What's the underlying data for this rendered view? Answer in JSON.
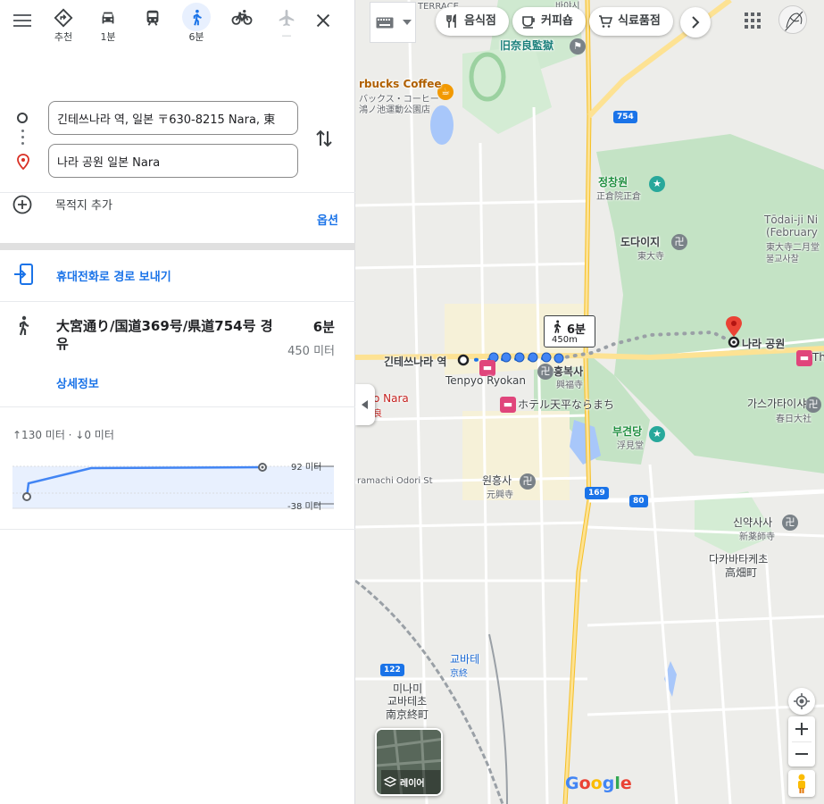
{
  "travel_modes": [
    {
      "id": "best",
      "label": "추천",
      "icon": "diamond-directions-icon"
    },
    {
      "id": "drive",
      "label": "1분",
      "icon": "car-icon"
    },
    {
      "id": "transit",
      "label": "",
      "icon": "train-icon"
    },
    {
      "id": "walk",
      "label": "6분",
      "icon": "walking-icon",
      "active": true
    },
    {
      "id": "bike",
      "label": "",
      "icon": "bicycle-icon"
    },
    {
      "id": "flight",
      "label": "—",
      "icon": "airplane-icon"
    }
  ],
  "directions": {
    "start_value": "긴테쓰나라 역, 일본 〒630-8215 Nara, 東",
    "destination_value": "나라 공원 일본 Nara",
    "add_destination": "목적지 추가",
    "options": "옵션",
    "send_to_phone": "휴대전화로 경로 보내기"
  },
  "route": {
    "name": "大宮通り/国道369号/県道754号 경유",
    "duration": "6분",
    "distance": "450 미터",
    "details": "상세정보"
  },
  "elevation": {
    "summary": "↑130 미터 · ↓0 미터",
    "max_label": "92 미터",
    "min_label": "-38 미터"
  },
  "map": {
    "chips": [
      {
        "label": "음식점",
        "icon": "restaurant-icon"
      },
      {
        "label": "커피숍",
        "icon": "coffee-icon"
      },
      {
        "label": "식료품점",
        "icon": "grocery-cart-icon"
      }
    ],
    "callout": {
      "duration": "6분",
      "distance": "450m"
    },
    "origin_label": "긴테쓰나라 역",
    "destination_label": "나라 공원",
    "layers_label": "레이어",
    "google": "Google",
    "labels": {
      "top": "바야시",
      "terrace": "TERRACE",
      "jail": "旧奈良監獄",
      "starbucks": "rbucks Coffee",
      "starbucks_jp": "バックス・コーヒー",
      "park_jp": "鴻ノ池運動公園店",
      "shosoin": "정창원",
      "shosoin_jp": "正倉院正倉",
      "todaiji_en": "Tōdai-ji Ni",
      "todaiji_en2": "(February",
      "todaiji_jp": "東大寺二月堂",
      "todaiji_kr": "불교사찰",
      "todaiji": "도다이지",
      "todaiji_sm": "東大寺",
      "kofukuji": "흥복사",
      "kofukuji_jp": "興福寺",
      "tenpyo": "Tenpyo Ryokan",
      "hotel": "ホテル天平ならまち",
      "nara_hotel": "o Nara",
      "nara_hotel2": "良",
      "kasuga": "가스가타이샤",
      "kasuga_jp": "春日大社",
      "ukimido": "부견당",
      "ukimido_jp": "浮見堂",
      "gangoji": "원흥사",
      "gangoji_jp": "元興寺",
      "naramachi": "ramachi Odori St",
      "shinyakushi": "신약사사",
      "shinyakushi_jp": "新薬師寺",
      "takabatake": "다카바타케초",
      "takabatake_jp": "高畑町",
      "kyobate": "교바테",
      "kyobate_jp": "京終",
      "minami": "미나미",
      "minami2": "교바테초",
      "minami_jp": "南京終町",
      "th": "Th"
    },
    "route_shields": [
      "754",
      "169",
      "80",
      "122"
    ]
  },
  "colors": {
    "accent": "#1a73e8",
    "park": "#c4e3c5",
    "road": "#fde293",
    "route": "#1a73e8"
  }
}
